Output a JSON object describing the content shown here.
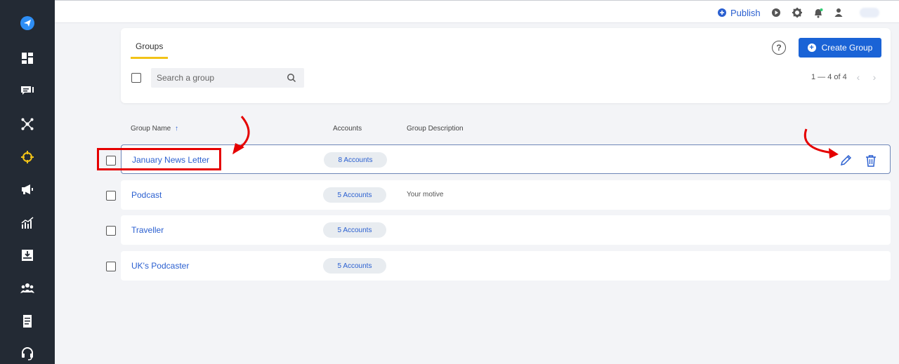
{
  "colors": {
    "sidebar": "#232a34",
    "accent": "#1a63d6",
    "link": "#2a5fd0",
    "tab_underline": "#f2c318",
    "annotation": "#e50000"
  },
  "sidebar": {
    "items": [
      {
        "icon": "paper-plane-icon",
        "active": false
      },
      {
        "icon": "dashboard-icon",
        "active": false
      },
      {
        "icon": "inbox-icon",
        "active": false
      },
      {
        "icon": "network-icon",
        "active": false
      },
      {
        "icon": "target-icon",
        "active": true
      },
      {
        "icon": "megaphone-icon",
        "active": false
      },
      {
        "icon": "analytics-icon",
        "active": false
      },
      {
        "icon": "download-icon",
        "active": false
      },
      {
        "icon": "team-icon",
        "active": false
      },
      {
        "icon": "document-icon",
        "active": false
      },
      {
        "icon": "headset-icon",
        "active": false
      }
    ]
  },
  "topbar": {
    "publish_label": "Publish",
    "icons": [
      "play-icon",
      "gear-icon",
      "bell-icon",
      "user-icon"
    ]
  },
  "header": {
    "tab_label": "Groups",
    "help_label": "?",
    "create_button_label": "Create Group",
    "search_placeholder": "Search a group",
    "pager_text": "1 — 4 of 4"
  },
  "table": {
    "columns": {
      "name": "Group Name",
      "sort_indicator": "↑",
      "accounts": "Accounts",
      "description": "Group Description"
    },
    "rows": [
      {
        "name": "January News Letter",
        "accounts": "8 Accounts",
        "description": ""
      },
      {
        "name": "Podcast",
        "accounts": "5 Accounts",
        "description": "Your motive"
      },
      {
        "name": "Traveller",
        "accounts": "5 Accounts",
        "description": ""
      },
      {
        "name": "UK's Podcaster",
        "accounts": "5 Accounts",
        "description": ""
      }
    ]
  }
}
